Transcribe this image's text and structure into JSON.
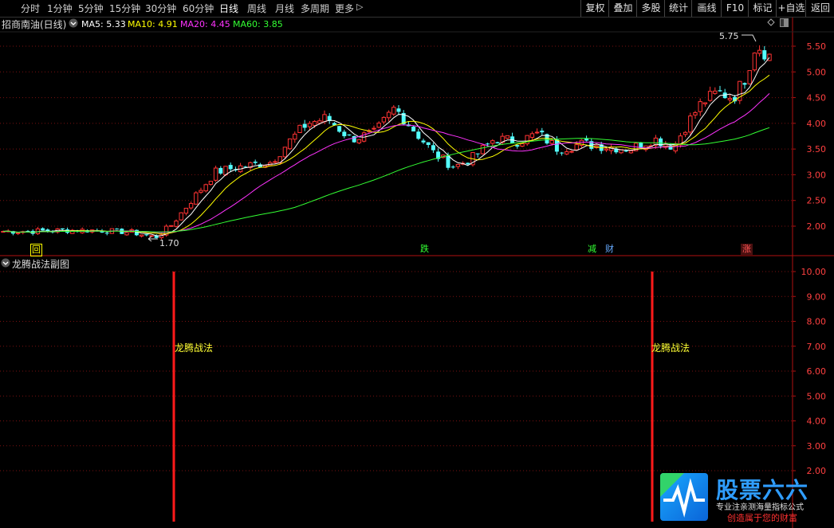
{
  "toolbar": {
    "periods": [
      "分时",
      "1分钟",
      "5分钟",
      "15分钟",
      "30分钟",
      "60分钟",
      "日线",
      "周线",
      "月线",
      "多周期",
      "更多"
    ],
    "active_period": "日线",
    "right_buttons": [
      "复权",
      "叠加",
      "多股",
      "统计",
      "画线",
      "F10",
      "标记",
      "+自选",
      "返回"
    ]
  },
  "main_chart": {
    "title": "招商南油(日线)",
    "ma": [
      {
        "label": "MA5: 5.33",
        "color": "#ffffff"
      },
      {
        "label": "MA10: 4.91",
        "color": "#ffff00"
      },
      {
        "label": "MA20: 4.45",
        "color": "#ff33ff"
      },
      {
        "label": "MA60: 3.85",
        "color": "#33ff33"
      }
    ],
    "high_label": "5.75",
    "low_label": "1.70",
    "yaxis_ticks": [
      "5.50",
      "5.00",
      "4.50",
      "4.00",
      "3.50",
      "3.00",
      "2.50",
      "2.00"
    ],
    "events": [
      {
        "label": "回",
        "color": "#ffff00"
      },
      {
        "label": "跌",
        "color": "#33ff33"
      },
      {
        "label": "减",
        "color": "#33ff33"
      },
      {
        "label": "财",
        "color": "#66aaff"
      },
      {
        "label": "涨",
        "color": "#ff5555"
      }
    ]
  },
  "sub_chart": {
    "title": "龙腾战法副图",
    "signal_label": "龙腾战法",
    "yaxis_ticks": [
      "10.00",
      "9.00",
      "8.00",
      "7.00",
      "6.00",
      "5.00",
      "4.00",
      "3.00",
      "2.00"
    ]
  },
  "colors": {
    "up": "#ff3333",
    "down": "#54ffff",
    "axis": "#b01010"
  },
  "logo": {
    "title": "股票六六",
    "subtitle1": "专业注亲测海量指标公式",
    "subtitle2": "创造属于您的财富"
  }
}
